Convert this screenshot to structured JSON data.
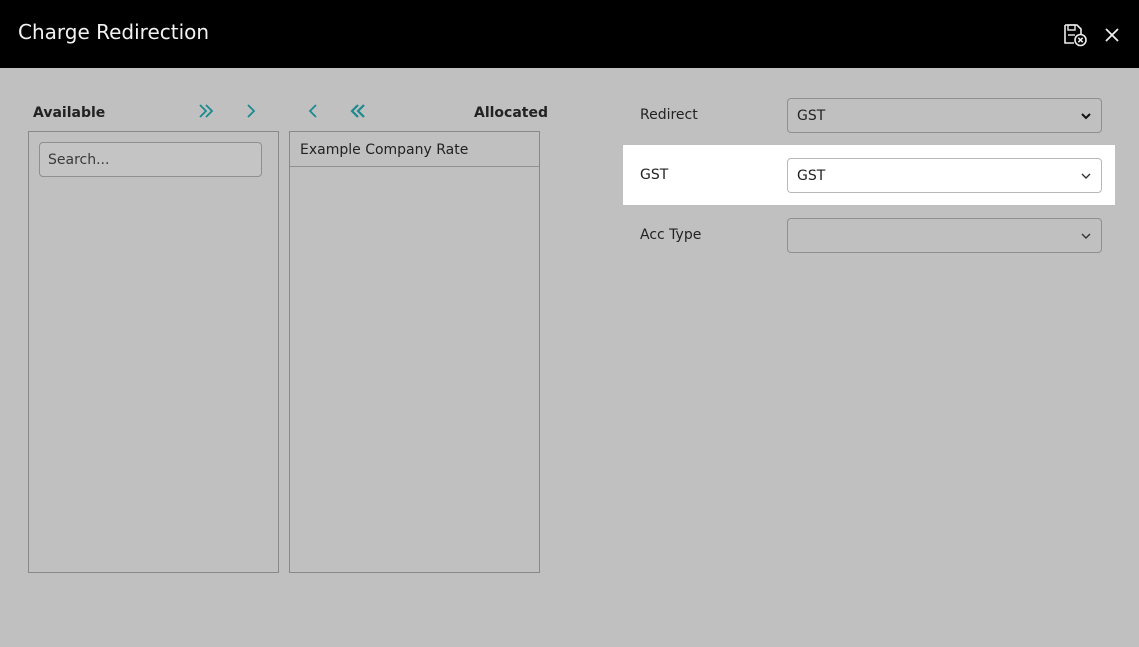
{
  "window": {
    "title": "Charge Redirection",
    "save_icon": "save-cancel-icon",
    "close_icon": "close-icon"
  },
  "allocation": {
    "available_label": "Available",
    "allocated_label": "Allocated",
    "search_placeholder": "Search...",
    "search_value": "",
    "available_items": [],
    "allocated_items": [
      {
        "label": "Example Company Rate"
      }
    ],
    "accent_color": "#1b8a8f"
  },
  "form": {
    "redirect": {
      "label": "Redirect",
      "value": "GST"
    },
    "gst": {
      "label": "GST",
      "value": "GST"
    },
    "acc_type": {
      "label": "Acc Type",
      "value": ""
    }
  }
}
